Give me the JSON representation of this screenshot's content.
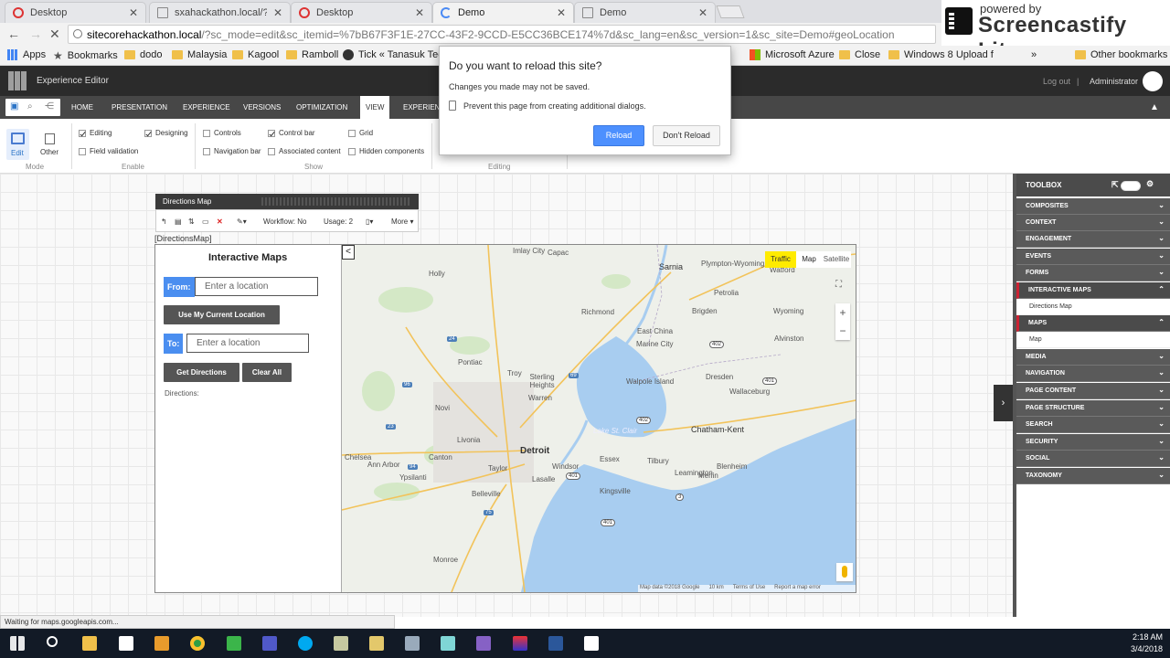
{
  "browser": {
    "tabs": [
      {
        "title": "Desktop",
        "icon": "opera-icon",
        "active": false
      },
      {
        "title": "sxahackathon.local/?sc_m",
        "icon": "page-icon",
        "active": false
      },
      {
        "title": "Desktop",
        "icon": "opera-icon",
        "active": false
      },
      {
        "title": "Demo",
        "icon": "loading-icon",
        "active": true
      },
      {
        "title": "Demo",
        "icon": "page-icon",
        "active": false
      }
    ],
    "url_domain": "sitecorehackathon.local",
    "url_rest": "/?sc_mode=edit&sc_itemid=%7bB67F3F1E-27CC-43F2-9CCD-E5CC36BCE174%7d&sc_lang=en&sc_version=1&sc_site=Demo#geoLocation",
    "bookmarks": [
      "Apps",
      "Bookmarks",
      "dodo",
      "Malaysia",
      "Kagool",
      "Ramboll",
      "Tick « Tanasuk Techn",
      "Microsoft Azure",
      "Close",
      "Windows 8 Upload f"
    ],
    "other_bookmarks": "Other bookmarks"
  },
  "watermark": {
    "powered": "powered by",
    "name": "Screencastify Lite"
  },
  "dialog": {
    "title": "Do you want to reload this site?",
    "message": "Changes you made may not be saved.",
    "prevent": "Prevent this page from creating additional dialogs.",
    "reload": "Reload",
    "dont_reload": "Don't Reload"
  },
  "editor": {
    "app_title": "Experience Editor",
    "logout": "Log out",
    "sep": "|",
    "user": "Administrator",
    "ribbon_tabs": [
      "HOME",
      "PRESENTATION",
      "EXPERIENCE",
      "VERSIONS",
      "OPTIMIZATION",
      "VIEW",
      "EXPERIEN"
    ],
    "selected_tab": "VIEW",
    "mode": {
      "edit": "Edit",
      "other": "Other",
      "label": "Mode"
    },
    "enable": {
      "editing": "Editing",
      "designing": "Designing",
      "field_validation": "Field validation",
      "label": "Enable"
    },
    "show": {
      "controls": "Controls",
      "control_bar": "Control bar",
      "grid": "Grid",
      "navigation_bar": "Navigation bar",
      "associated_content": "Associated content",
      "hidden_components": "Hidden components",
      "label": "Show"
    },
    "editing_group": "Editing"
  },
  "rendering": {
    "chrome_title": "Directions Map",
    "workflow": "Workflow: No",
    "usage": "Usage: 2",
    "more": "More",
    "component_name": "[DirectionsMap]"
  },
  "directions_panel": {
    "heading": "Interactive Maps",
    "from_label": "From:",
    "from_placeholder": "Enter a location",
    "current_location": "Use My Current Location",
    "to_label": "To:",
    "to_placeholder": "Enter a location",
    "get_directions": "Get Directions",
    "clear_all": "Clear All",
    "directions_label": "Directions:"
  },
  "map": {
    "collapse": "<",
    "traffic": "Traffic",
    "map": "Map",
    "satellite": "Satellite",
    "zoom_in": "+",
    "zoom_out": "−",
    "attribution": [
      "Map data ©2018 Google",
      "10 km",
      "Terms of Use",
      "Report a map error"
    ],
    "places": [
      "Imlay City",
      "Capac",
      "Sarnia",
      "Plympton-Wyoming",
      "Watford",
      "Petrolia",
      "Holly",
      "Richmond",
      "Brigden",
      "Wyoming",
      "Alvinston",
      "East China",
      "Marine City",
      "Pontiac",
      "Troy",
      "Sterling Heights",
      "Warren",
      "Walpole Island",
      "Dresden",
      "Wallaceburg",
      "Novi",
      "Livonia",
      "Canton",
      "Detroit",
      "Lake St. Clair",
      "Chatham-Kent",
      "Ann Arbor",
      "Ypsilanti",
      "Chelsea",
      "Belleville",
      "Lasalle",
      "Essex",
      "Kingsville",
      "Leamington",
      "Merlin",
      "Blenheim",
      "Tilbury",
      "Taylor",
      "Windsor",
      "Monroe"
    ],
    "shields": [
      "94",
      "402",
      "402",
      "401",
      "401",
      "401",
      "24",
      "96",
      "69",
      "23",
      "75",
      "3"
    ]
  },
  "toolbox": {
    "title": "TOOLBOX",
    "sections": [
      {
        "name": "COMPOSITES",
        "open": false
      },
      {
        "name": "CONTEXT",
        "open": false
      },
      {
        "name": "ENGAGEMENT",
        "open": false
      },
      {
        "name": "EVENTS",
        "open": false
      },
      {
        "name": "FORMS",
        "open": false
      },
      {
        "name": "INTERACTIVE MAPS",
        "open": true,
        "items": [
          "Directions Map"
        ]
      },
      {
        "name": "MAPS",
        "open": true,
        "items": [
          "Map"
        ]
      },
      {
        "name": "MEDIA",
        "open": false
      },
      {
        "name": "NAVIGATION",
        "open": false
      },
      {
        "name": "PAGE CONTENT",
        "open": false
      },
      {
        "name": "PAGE STRUCTURE",
        "open": false
      },
      {
        "name": "SEARCH",
        "open": false
      },
      {
        "name": "SECURITY",
        "open": false
      },
      {
        "name": "SOCIAL",
        "open": false
      },
      {
        "name": "TAXONOMY",
        "open": false
      }
    ]
  },
  "status": "Waiting for maps.googleapis.com...",
  "taskbar": {
    "time": "2:18 AM",
    "date": "3/4/2018"
  },
  "colors": {
    "accent": "#4d90fe",
    "ribbon": "#474747",
    "header": "#2b2b2b",
    "traffic": "#ffeb00",
    "water": "#a8cdf0",
    "toolbox_open": "#c23"
  }
}
